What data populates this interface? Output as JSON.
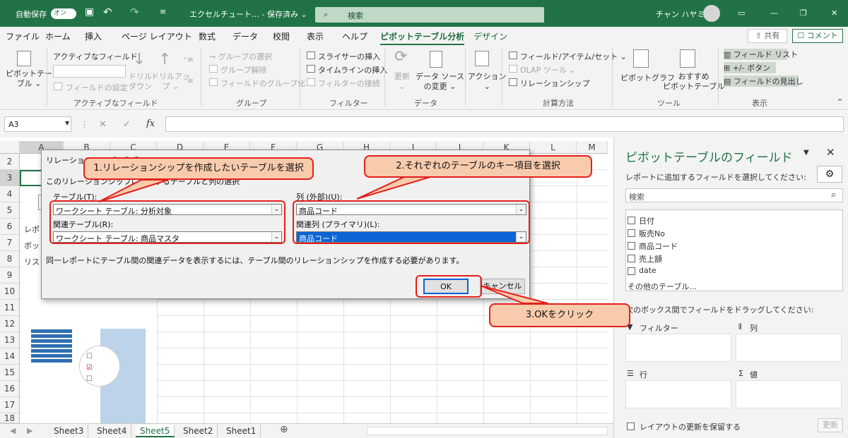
{
  "titlebar": {
    "autosave_label": "自動保存",
    "autosave_state": "オン",
    "doc_name": "エクセルチュート… - 保存済み ⌄",
    "search_placeholder": "検索",
    "user_name": "チャン ハヤミ"
  },
  "tabs": [
    "ファイル",
    "ホーム",
    "挿入",
    "ページ レイアウト",
    "数式",
    "データ",
    "校閲",
    "表示",
    "ヘルプ",
    "ピボットテーブル分析",
    "デザイン"
  ],
  "share_label": "共有",
  "comment_label": "コメント",
  "ribbon": {
    "pivot_table": "ピボットテー\nブル ⌄",
    "active_field_label": "アクティブなフィールド:",
    "field_settings": "フィールドの設定",
    "drill_down": "ドリル\nダウン",
    "drill_up": "ドリルアッ\nプ ⌄",
    "group_selection": "→ グループの選択",
    "ungroup": "グループ解除",
    "group_field": "フィールドのグループ化",
    "insert_slicer": "スライサーの挿入",
    "insert_timeline": "タイムラインの挿入",
    "filter_connections": "フィルターの接続",
    "refresh": "更新\n⌄",
    "change_source": "データ ソース\nの変更 ⌄",
    "actions": "アクション\n⌄",
    "fields_items_sets": "フィールド/アイテム/セット ⌄",
    "olap_tools": "OLAP ツール ⌄",
    "relationships": "リレーションシップ",
    "pivot_chart": "ピボットグラフ",
    "recommended": "おすすめ\nピボットテーブル",
    "field_list": "フィールド リスト",
    "plus_minus": "+/- ボタン",
    "field_headers": "フィールドの見出し",
    "groups": {
      "active_field": "アクティブなフィールド",
      "group": "グループ",
      "filter": "フィルター",
      "data": "データ",
      "calculations": "計算方法",
      "tools": "ツール",
      "show": "表示"
    }
  },
  "formula": {
    "name_box": "A3",
    "fx": "fx"
  },
  "grid": {
    "columns": [
      "A",
      "B",
      "C",
      "D",
      "E",
      "F",
      "G",
      "H",
      "I",
      "J",
      "K",
      "L",
      "M"
    ],
    "rows": [
      "1",
      "2",
      "3",
      "4",
      "5",
      "6",
      "7",
      "8",
      "9",
      "10",
      "11",
      "12",
      "13",
      "14",
      "15",
      "16",
      "17",
      "18"
    ],
    "partial_texts": [
      "レポ",
      "ボッ",
      "リス"
    ]
  },
  "sheets": [
    "Sheet3",
    "Sheet4",
    "Sheet5",
    "Sheet2",
    "Sheet1"
  ],
  "active_sheet": "Sheet5",
  "dialog": {
    "title": "リレーションシップの作成",
    "subtitle": "このリレーションシップに使用するテーブルと列の選択",
    "table_label": "テーブル(T):",
    "table_value": "ワークシート テーブル: 分析対象",
    "column_label": "列 (外部)(U):",
    "column_value": "商品コード",
    "related_table_label": "関連テーブル(R):",
    "related_table_value": "ワークシート テーブル: 商品マスタ",
    "related_column_label": "関連列 (プライマリ)(L):",
    "related_column_value": "商品コード",
    "note": "同一レポートにテーブル間の関連データを表示するには、テーブル間のリレーションシップを作成する必要があります。",
    "ok": "OK",
    "cancel": "キャンセル"
  },
  "callouts": {
    "step1": "1.リレーションシップを作成したいテーブルを選択",
    "step2": "2.それぞれのテーブルのキー項目を選択",
    "step3": "3.OKをクリック"
  },
  "pane": {
    "title": "ピボットテーブルのフィールド",
    "instruction": "レポートに追加するフィールドを選択してください:",
    "search_placeholder": "検索",
    "fields": [
      "日付",
      "販売No",
      "商品コード",
      "売上額",
      "date"
    ],
    "other_tables": "その他のテーブル...",
    "drag_instruction": "次のボックス間でフィールドをドラッグしてください:",
    "filters": "フィルター",
    "columns": "列",
    "rows": "行",
    "values": "値",
    "defer_update": "レイアウトの更新を保留する",
    "update": "更新"
  },
  "colors": {
    "brand": "#217346",
    "callout_fill": "#f8cbad",
    "callout_border": "#e3201b",
    "selection": "#0a64d6"
  }
}
